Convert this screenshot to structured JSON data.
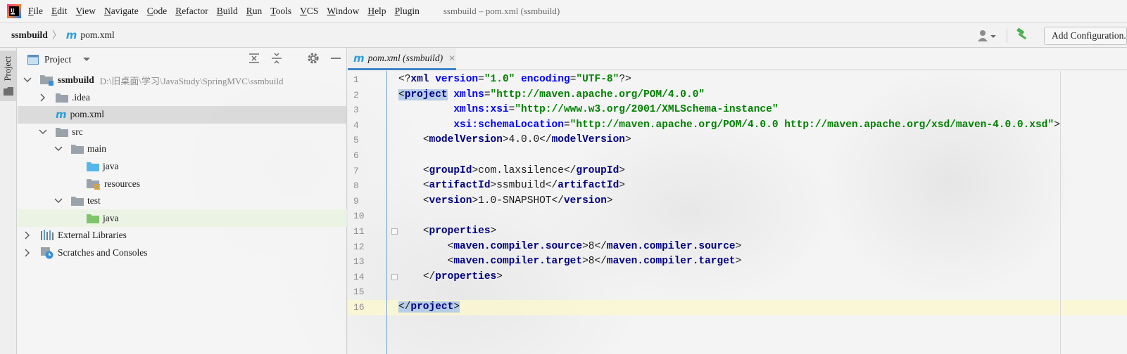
{
  "menubar": {
    "items": [
      "File",
      "Edit",
      "View",
      "Navigate",
      "Code",
      "Refactor",
      "Build",
      "Run",
      "Tools",
      "VCS",
      "Window",
      "Help",
      "Plugin"
    ],
    "mnemonics": [
      "F",
      "E",
      "V",
      "N",
      "C",
      "R",
      "B",
      "R",
      "T",
      "V",
      "W",
      "H",
      "P"
    ],
    "title": "ssmbuild – pom.xml (ssmbuild)"
  },
  "navbar": {
    "project": "ssmbuild",
    "file": "pom.xml",
    "add_configuration": "Add Configuration...",
    "accent_color": "#2d9fd8",
    "hammer_color": "#4caf50"
  },
  "left_stripe": {
    "project_tab": "Project"
  },
  "project_panel": {
    "title": "Project",
    "tree": [
      {
        "label": "ssmbuild",
        "hint": "D:\\旧桌面\\学习\\JavaStudy\\SpringMVC\\ssmbuild",
        "depth": 0,
        "chevron": "down",
        "icon": "module-folder"
      },
      {
        "label": ".idea",
        "hint": "",
        "depth": 1,
        "chevron": "right",
        "icon": "folder"
      },
      {
        "label": "pom.xml",
        "hint": "",
        "depth": 1,
        "chevron": "none",
        "icon": "maven-file"
      },
      {
        "label": "src",
        "hint": "",
        "depth": 1,
        "chevron": "down",
        "icon": "folder"
      },
      {
        "label": "main",
        "hint": "",
        "depth": 2,
        "chevron": "down",
        "icon": "folder"
      },
      {
        "label": "java",
        "hint": "",
        "depth": 3,
        "chevron": "none",
        "icon": "source-folder"
      },
      {
        "label": "resources",
        "hint": "",
        "depth": 3,
        "chevron": "none",
        "icon": "resources-folder"
      },
      {
        "label": "test",
        "hint": "",
        "depth": 2,
        "chevron": "down",
        "icon": "folder"
      },
      {
        "label": "java",
        "hint": "",
        "depth": 3,
        "chevron": "none",
        "icon": "test-folder"
      },
      {
        "label": "External Libraries",
        "hint": "",
        "depth": 0,
        "chevron": "right",
        "icon": "library"
      },
      {
        "label": "Scratches and Consoles",
        "hint": "",
        "depth": 0,
        "chevron": "right",
        "icon": "scratches"
      }
    ]
  },
  "editor": {
    "tab_label": "pom.xml (ssmbuild)",
    "current_line": 16,
    "line_numbers": [
      "1",
      "2",
      "3",
      "4",
      "5",
      "6",
      "7",
      "8",
      "9",
      "10",
      "11",
      "12",
      "13",
      "14",
      "15",
      "16"
    ],
    "lines": [
      "<?xml version=\"1.0\" encoding=\"UTF-8\"?>",
      "<project xmlns=\"http://maven.apache.org/POM/4.0.0\"",
      "         xmlns:xsi=\"http://www.w3.org/2001/XMLSchema-instance\"",
      "         xsi:schemaLocation=\"http://maven.apache.org/POM/4.0.0 http://maven.apache.org/xsd/maven-4.0.0.xsd\">",
      "    <modelVersion>4.0.0</modelVersion>",
      "",
      "    <groupId>com.laxsilence</groupId>",
      "    <artifactId>ssmbuild</artifactId>",
      "    <version>1.0-SNAPSHOT</version>",
      "",
      "    <properties>",
      "        <maven.compiler.source>8</maven.compiler.source>",
      "        <maven.compiler.target>8</maven.compiler.target>",
      "    </properties>",
      "",
      "</project>"
    ]
  }
}
